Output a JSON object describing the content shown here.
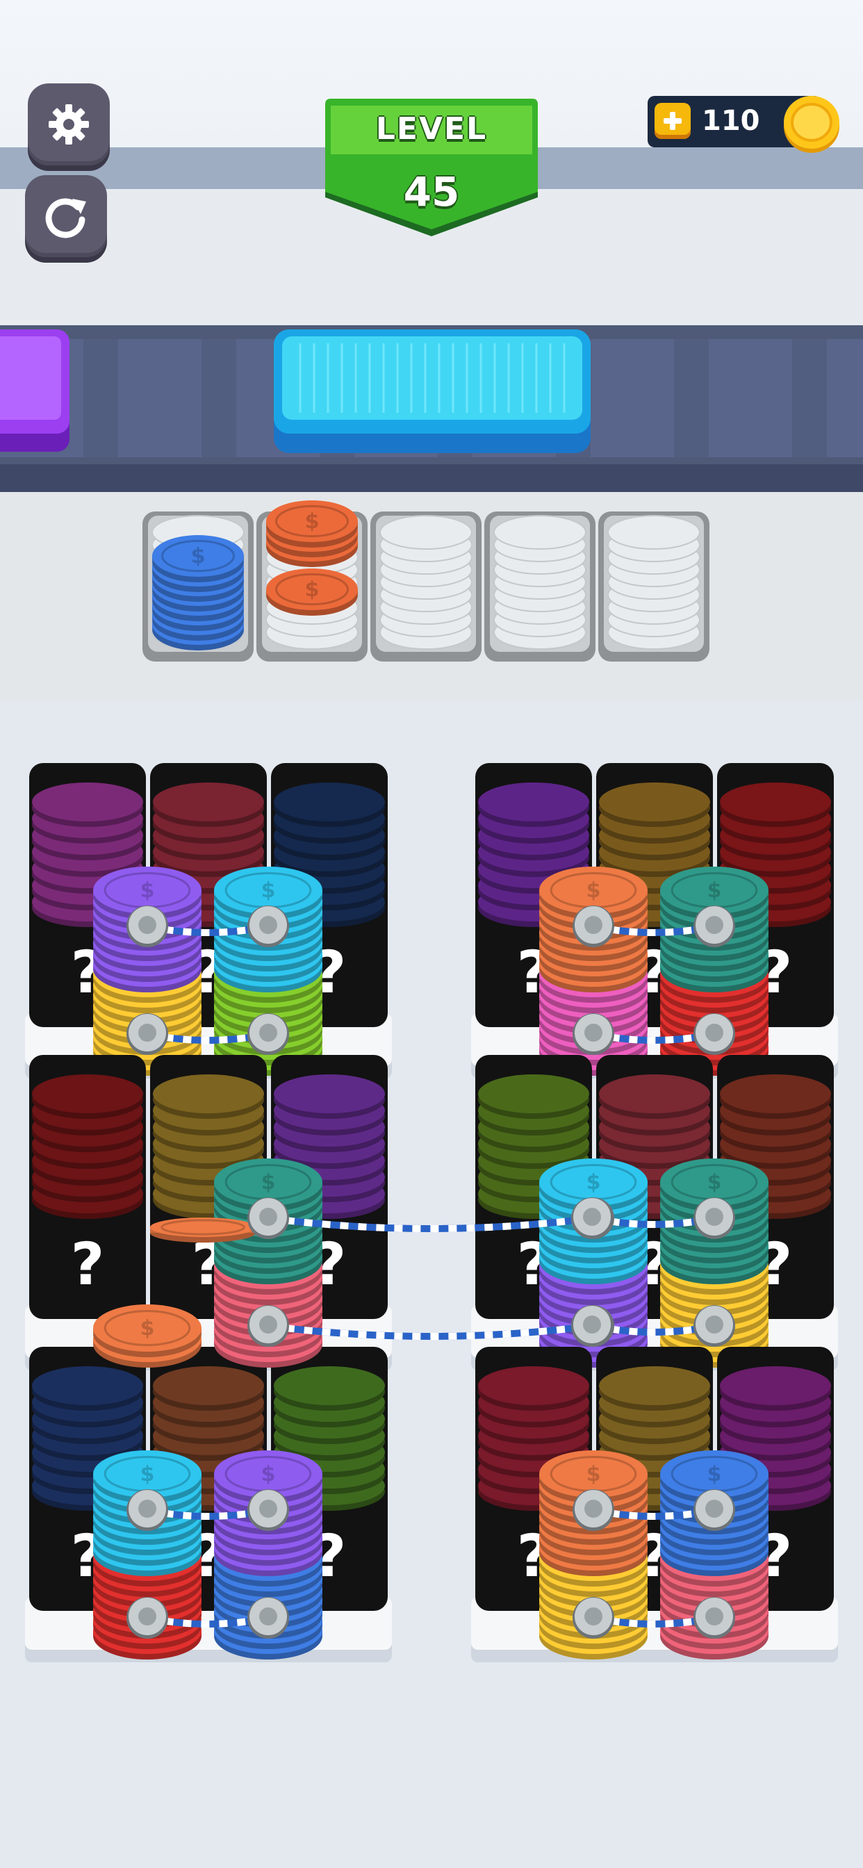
{
  "hud": {
    "level_label": "LEVEL",
    "level_number": "45",
    "coins": "110",
    "settings_icon": "gear-icon",
    "restart_icon": "restart-icon",
    "add_coins_icon": "plus-icon",
    "coin_icon": "gold-coin-icon"
  },
  "conveyor": {
    "active_box_color": "#35d2f2",
    "left_box_color": "#9b3ff0"
  },
  "holding_tray": {
    "slots": [
      {
        "color": "#3f7ee6",
        "filled": true
      },
      {
        "color": "#ec6a3a",
        "filled": true
      },
      {
        "color": "#dfe3e6",
        "filled": false
      },
      {
        "color": "#dfe3e6",
        "filled": false
      },
      {
        "color": "#dfe3e6",
        "filled": false
      }
    ]
  },
  "hidden_marker": "?",
  "colors": {
    "purple": "#8f5cf0",
    "cyan": "#2ec6ef",
    "yellow": "#ffcc34",
    "green": "#86cf2d",
    "orange": "#ef7a45",
    "teal": "#2f9a8a",
    "pink": "#ee5fbf",
    "red": "#e3302e",
    "salmon": "#f0647a",
    "blue": "#3f7ee6"
  }
}
